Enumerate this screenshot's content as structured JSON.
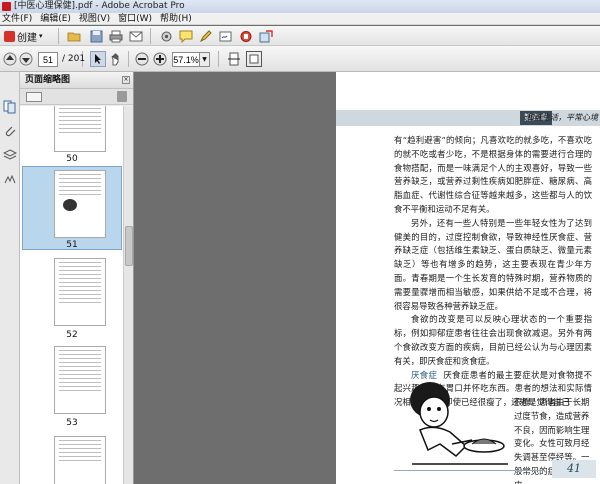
{
  "window": {
    "title": "[中医心理保健].pdf - Adobe Acrobat Pro"
  },
  "menu": [
    "文件(F)",
    "编辑(E)",
    "视图(V)",
    "窗口(W)",
    "帮助(H)"
  ],
  "toolbar": {
    "create_label": "创建",
    "icons": [
      "open-icon",
      "save-icon",
      "print-icon",
      "email-icon",
      "settings-icon",
      "comment-icon",
      "edit-icon",
      "sign-icon",
      "stamp-icon",
      "share-icon"
    ]
  },
  "nav": {
    "current_page": "51",
    "total_pages": "/ 201",
    "zoom": "57.1%"
  },
  "panel": {
    "title": "页面缩略图",
    "thumbnails": [
      {
        "label": "50"
      },
      {
        "label": "51",
        "selected": true
      },
      {
        "label": "52"
      },
      {
        "label": "53"
      }
    ]
  },
  "page": {
    "chapter_tag": "第四章",
    "header_text": "和谐生活，平常心境",
    "paragraphs": [
      "有“趋利避害”的倾向；凡喜欢吃的就多吃，不喜欢吃的就不吃或者少吃，不是根据身体的需要进行合理的食物搭配，而是一味满足个人的主观喜好，导致一些营养缺乏，或营养过剩性疾病如肥胖症、糖尿病、高脂血症、代谢性综合征等越来越多，这些都与人的饮食不平衡和运动不足有关。",
      "另外，还有一些人特别是一些年轻女性为了达到健美的目的，过度控制食欲，导致神经性厌食症、营养缺乏症（包括维生素缺乏、蛋白质缺乏、微量元素缺乏）等也有增多的趋势，这主要表现在青少年方面。青春期是一个生长发育的特殊时期，营养物质的需要量骤增而相当敏感，如果供给不足或不合理，将很容易导致各种营养缺乏症。",
      "食欲的改变是可以反映心理状态的一个重要指标，例如抑郁症患者往往会出现食欲减退。另外有两个食欲改变方面的疾病，目前已经公认为与心理因素有关，即厌食症和贪食症。"
    ],
    "anorexia_term": "厌食症",
    "anorexia_text": "厌食症患者的最主要症状是对食物提不起兴趣，没有胃口并怀吃东西。患者的想法和实际情况相差很远，即使已经很瘦了，还老是觉得自己",
    "narrow_text": "很胖。患者由于长期过度节食，造成营养不良，因而影响生理变化。女性可致月经失调甚至停经等。一般常见的症状包括：皮",
    "page_number": "41"
  }
}
